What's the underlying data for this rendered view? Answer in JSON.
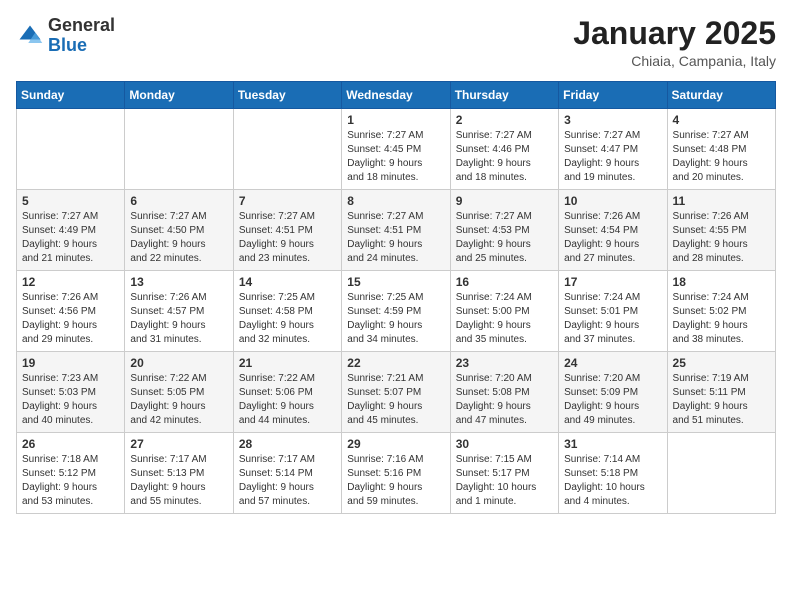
{
  "header": {
    "logo": {
      "general": "General",
      "blue": "Blue"
    },
    "title": "January 2025",
    "location": "Chiaia, Campania, Italy"
  },
  "weekdays": [
    "Sunday",
    "Monday",
    "Tuesday",
    "Wednesday",
    "Thursday",
    "Friday",
    "Saturday"
  ],
  "weeks": [
    [
      {
        "day": "",
        "info": ""
      },
      {
        "day": "",
        "info": ""
      },
      {
        "day": "",
        "info": ""
      },
      {
        "day": "1",
        "info": "Sunrise: 7:27 AM\nSunset: 4:45 PM\nDaylight: 9 hours\nand 18 minutes."
      },
      {
        "day": "2",
        "info": "Sunrise: 7:27 AM\nSunset: 4:46 PM\nDaylight: 9 hours\nand 18 minutes."
      },
      {
        "day": "3",
        "info": "Sunrise: 7:27 AM\nSunset: 4:47 PM\nDaylight: 9 hours\nand 19 minutes."
      },
      {
        "day": "4",
        "info": "Sunrise: 7:27 AM\nSunset: 4:48 PM\nDaylight: 9 hours\nand 20 minutes."
      }
    ],
    [
      {
        "day": "5",
        "info": "Sunrise: 7:27 AM\nSunset: 4:49 PM\nDaylight: 9 hours\nand 21 minutes."
      },
      {
        "day": "6",
        "info": "Sunrise: 7:27 AM\nSunset: 4:50 PM\nDaylight: 9 hours\nand 22 minutes."
      },
      {
        "day": "7",
        "info": "Sunrise: 7:27 AM\nSunset: 4:51 PM\nDaylight: 9 hours\nand 23 minutes."
      },
      {
        "day": "8",
        "info": "Sunrise: 7:27 AM\nSunset: 4:51 PM\nDaylight: 9 hours\nand 24 minutes."
      },
      {
        "day": "9",
        "info": "Sunrise: 7:27 AM\nSunset: 4:53 PM\nDaylight: 9 hours\nand 25 minutes."
      },
      {
        "day": "10",
        "info": "Sunrise: 7:26 AM\nSunset: 4:54 PM\nDaylight: 9 hours\nand 27 minutes."
      },
      {
        "day": "11",
        "info": "Sunrise: 7:26 AM\nSunset: 4:55 PM\nDaylight: 9 hours\nand 28 minutes."
      }
    ],
    [
      {
        "day": "12",
        "info": "Sunrise: 7:26 AM\nSunset: 4:56 PM\nDaylight: 9 hours\nand 29 minutes."
      },
      {
        "day": "13",
        "info": "Sunrise: 7:26 AM\nSunset: 4:57 PM\nDaylight: 9 hours\nand 31 minutes."
      },
      {
        "day": "14",
        "info": "Sunrise: 7:25 AM\nSunset: 4:58 PM\nDaylight: 9 hours\nand 32 minutes."
      },
      {
        "day": "15",
        "info": "Sunrise: 7:25 AM\nSunset: 4:59 PM\nDaylight: 9 hours\nand 34 minutes."
      },
      {
        "day": "16",
        "info": "Sunrise: 7:24 AM\nSunset: 5:00 PM\nDaylight: 9 hours\nand 35 minutes."
      },
      {
        "day": "17",
        "info": "Sunrise: 7:24 AM\nSunset: 5:01 PM\nDaylight: 9 hours\nand 37 minutes."
      },
      {
        "day": "18",
        "info": "Sunrise: 7:24 AM\nSunset: 5:02 PM\nDaylight: 9 hours\nand 38 minutes."
      }
    ],
    [
      {
        "day": "19",
        "info": "Sunrise: 7:23 AM\nSunset: 5:03 PM\nDaylight: 9 hours\nand 40 minutes."
      },
      {
        "day": "20",
        "info": "Sunrise: 7:22 AM\nSunset: 5:05 PM\nDaylight: 9 hours\nand 42 minutes."
      },
      {
        "day": "21",
        "info": "Sunrise: 7:22 AM\nSunset: 5:06 PM\nDaylight: 9 hours\nand 44 minutes."
      },
      {
        "day": "22",
        "info": "Sunrise: 7:21 AM\nSunset: 5:07 PM\nDaylight: 9 hours\nand 45 minutes."
      },
      {
        "day": "23",
        "info": "Sunrise: 7:20 AM\nSunset: 5:08 PM\nDaylight: 9 hours\nand 47 minutes."
      },
      {
        "day": "24",
        "info": "Sunrise: 7:20 AM\nSunset: 5:09 PM\nDaylight: 9 hours\nand 49 minutes."
      },
      {
        "day": "25",
        "info": "Sunrise: 7:19 AM\nSunset: 5:11 PM\nDaylight: 9 hours\nand 51 minutes."
      }
    ],
    [
      {
        "day": "26",
        "info": "Sunrise: 7:18 AM\nSunset: 5:12 PM\nDaylight: 9 hours\nand 53 minutes."
      },
      {
        "day": "27",
        "info": "Sunrise: 7:17 AM\nSunset: 5:13 PM\nDaylight: 9 hours\nand 55 minutes."
      },
      {
        "day": "28",
        "info": "Sunrise: 7:17 AM\nSunset: 5:14 PM\nDaylight: 9 hours\nand 57 minutes."
      },
      {
        "day": "29",
        "info": "Sunrise: 7:16 AM\nSunset: 5:16 PM\nDaylight: 9 hours\nand 59 minutes."
      },
      {
        "day": "30",
        "info": "Sunrise: 7:15 AM\nSunset: 5:17 PM\nDaylight: 10 hours\nand 1 minute."
      },
      {
        "day": "31",
        "info": "Sunrise: 7:14 AM\nSunset: 5:18 PM\nDaylight: 10 hours\nand 4 minutes."
      },
      {
        "day": "",
        "info": ""
      }
    ]
  ]
}
